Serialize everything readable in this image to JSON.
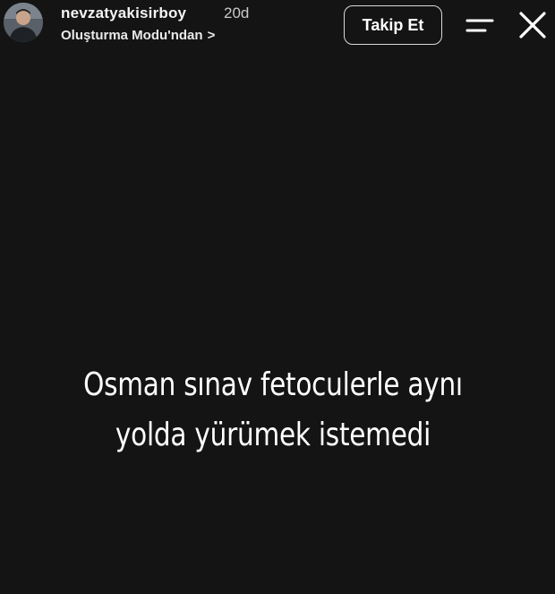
{
  "header": {
    "username": "nevzatyakisirboy",
    "time_ago": "20d",
    "subtitle": "Oluşturma Modu'ndan",
    "subtitle_chevron": ">",
    "follow_label": "Takip Et",
    "avatar_icon": "user-avatar",
    "menu_icon": "menu-icon",
    "close_icon": "close-icon"
  },
  "story": {
    "line1": "Osman sınav fetoculerle aynı",
    "line2": "yolda yürümek istemedi"
  },
  "colors": {
    "background": "#141414",
    "text": "#ffffff",
    "secondary_text": "#c9c9c9"
  }
}
